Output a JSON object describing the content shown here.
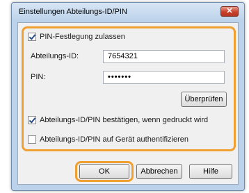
{
  "dialog": {
    "title": "Einstellungen Abteilungs-ID/PIN",
    "close_label": "✕"
  },
  "settings": {
    "pin_enable": {
      "label": "PIN-Festlegung zulassen",
      "checked": true
    },
    "dept_id": {
      "label": "Abteilungs-ID:",
      "value": "7654321"
    },
    "pin": {
      "label": "PIN:",
      "value": "•••••••"
    },
    "check_button": "Überprüfen",
    "confirm_print": {
      "label": "Abteilungs-ID/PIN bestätigen, wenn gedruckt wird",
      "checked": true
    },
    "auth_device": {
      "label": "Abteilungs-ID/PIN auf Gerät authentifizieren",
      "checked": false
    }
  },
  "buttons": {
    "ok": "OK",
    "cancel": "Abbrechen",
    "help": "Hilfe"
  },
  "colors": {
    "highlight": "#f0a030",
    "frame": "#bcd2ea"
  }
}
